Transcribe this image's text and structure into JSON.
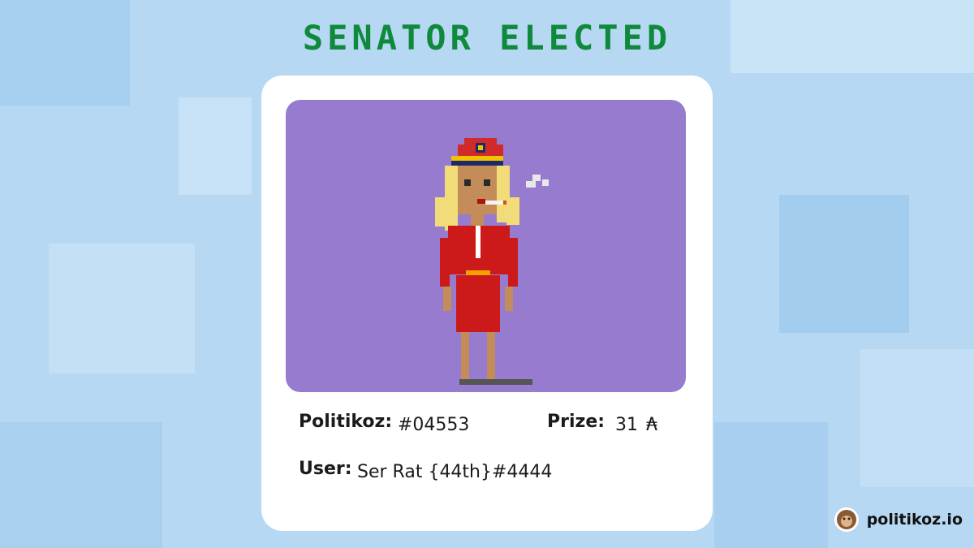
{
  "page": {
    "title": "SENATOR ELECTED"
  },
  "card": {
    "politikoz_label": "Politikoz:",
    "politikoz_value": "#04553",
    "prize_label": "Prize:",
    "prize_value": "31",
    "prize_currency_icon": "ada-icon",
    "user_label": "User:",
    "user_value": "Ser Rat {44th}#4444",
    "art": {
      "background_color": "#967bcf",
      "subject": "pixel-character-senator"
    }
  },
  "footer": {
    "site": "politikoz.io",
    "logo_icon": "monkey-avatar-icon"
  },
  "colors": {
    "title_green": "#0f8a3c",
    "page_bg": "#b7d8f2",
    "card_bg": "#ffffff"
  }
}
